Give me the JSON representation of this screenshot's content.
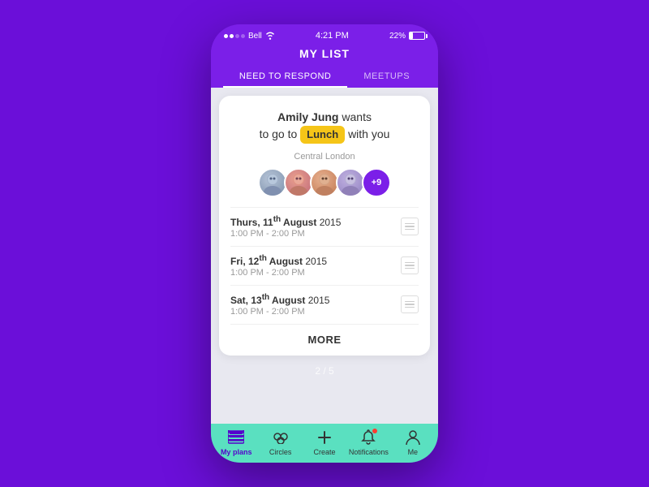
{
  "statusBar": {
    "carrier": "Bell",
    "time": "4:21 PM",
    "battery": "22%"
  },
  "header": {
    "title": "MY LIST"
  },
  "tabs": [
    {
      "id": "need-to-respond",
      "label": "NEED TO RESPOND",
      "active": true
    },
    {
      "id": "meetups",
      "label": "MEETUPS",
      "active": false
    }
  ],
  "card": {
    "invite": {
      "name": "Amily Jung",
      "action": "wants",
      "preposition": "to go to",
      "activity": "Lunch",
      "suffix": "with you"
    },
    "location": "Central London",
    "avatarCount": "+9",
    "dates": [
      {
        "day": "Thurs, 11",
        "sup": "th",
        "rest": " August 2015",
        "time": "1:00 PM - 2:00 PM"
      },
      {
        "day": "Fri, 12",
        "sup": "th",
        "rest": " August 2015",
        "time": "1:00 PM - 2:00 PM"
      },
      {
        "day": "Sat, 13",
        "sup": "th",
        "rest": " August 2015",
        "time": "1:00 PM - 2:00 PM"
      }
    ],
    "moreLabel": "MORE"
  },
  "pagination": "2 / 5",
  "bottomNav": [
    {
      "id": "my-plans",
      "label": "My plans",
      "active": true,
      "icon": "list"
    },
    {
      "id": "circles",
      "label": "Circles",
      "active": false,
      "icon": "circles"
    },
    {
      "id": "create",
      "label": "Create",
      "active": false,
      "icon": "plus"
    },
    {
      "id": "notifications",
      "label": "Notifications",
      "active": false,
      "icon": "bell",
      "badge": true
    },
    {
      "id": "me",
      "label": "Me",
      "active": false,
      "icon": "person"
    }
  ]
}
